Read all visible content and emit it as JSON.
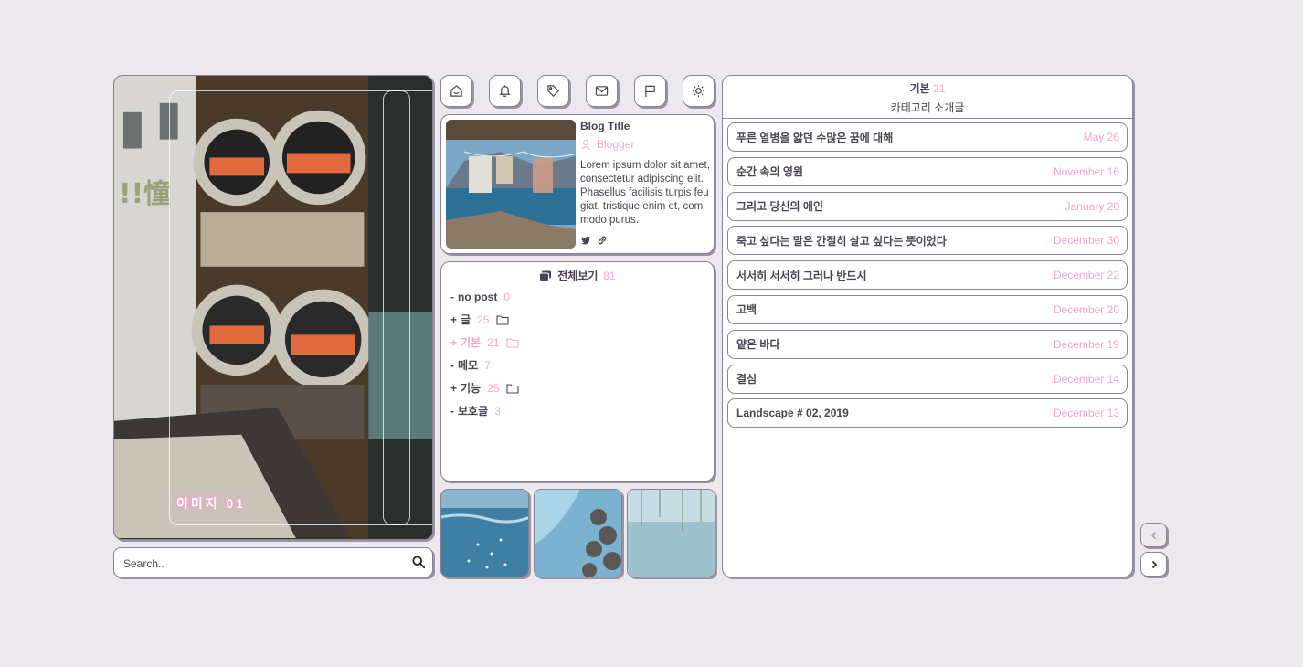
{
  "hero": {
    "caption": "이미지 01"
  },
  "search": {
    "placeholder": "Search.."
  },
  "toolbar": [
    {
      "name": "home-icon"
    },
    {
      "name": "bell-icon"
    },
    {
      "name": "tag-icon"
    },
    {
      "name": "mail-icon"
    },
    {
      "name": "flag-icon"
    },
    {
      "name": "sun-icon"
    }
  ],
  "profile": {
    "title": "Blog Title",
    "user": "Blogger",
    "description": "Lorem ipsum dolor sit amet, consectetur adipiscing elit. Phasellus facilisis turpis feugiat, tristique enim et, commodo purus."
  },
  "category": {
    "title": "전체보기",
    "count": "81",
    "items": [
      {
        "prefix": "-",
        "label": "no post",
        "count": "0",
        "folder": false,
        "active": false
      },
      {
        "prefix": "+",
        "label": "글",
        "count": "25",
        "folder": true,
        "active": false
      },
      {
        "prefix": "+",
        "label": "기본",
        "count": "21",
        "folder": true,
        "active": true
      },
      {
        "prefix": "-",
        "label": "메모",
        "count": "7",
        "folder": false,
        "active": false
      },
      {
        "prefix": "+",
        "label": "기능",
        "count": "25",
        "folder": true,
        "active": false
      },
      {
        "prefix": "-",
        "label": "보호글",
        "count": "3",
        "folder": false,
        "active": false
      }
    ]
  },
  "posts": {
    "category": "기본",
    "count": "21",
    "description": "카테고리 소개글",
    "items": [
      {
        "title": "푸른 열병을 앓던 수많은 꿈에 대해",
        "date": "May 26"
      },
      {
        "title": "순간 속의 영원",
        "date": "November 16"
      },
      {
        "title": "그리고 당신의 애인",
        "date": "January 20"
      },
      {
        "title": "죽고 싶다는 말은 간절히 살고 싶다는 뜻이었다",
        "date": "December 30"
      },
      {
        "title": "서서히 서서히 그러나 반드시",
        "date": "December 22"
      },
      {
        "title": "고백",
        "date": "December 20"
      },
      {
        "title": "얕은 바다",
        "date": "December 19"
      },
      {
        "title": "결심",
        "date": "December 14"
      },
      {
        "title": "Landscape # 02, 2019",
        "date": "December 13"
      }
    ]
  },
  "colors": {
    "accent": "#f0a9cc",
    "text": "#4a4452",
    "border": "#8a8294",
    "background": "#ebe9ed"
  }
}
